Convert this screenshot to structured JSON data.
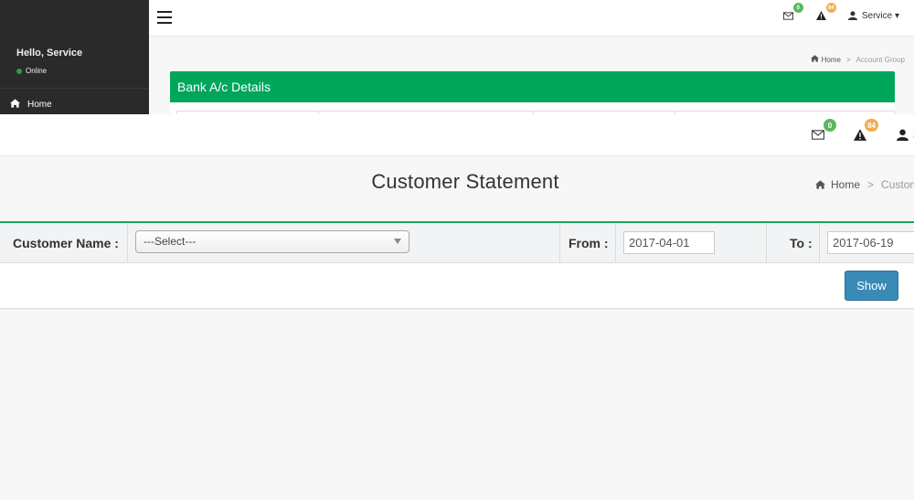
{
  "background_page": {
    "sidebar": {
      "greeting": "Hello, Service",
      "status": "Online",
      "nav_home": "Home"
    },
    "topbar": {
      "mail_count": "0",
      "alert_count": "84",
      "user_label": "Service ▾"
    },
    "breadcrumb": {
      "home": "Home",
      "separator": ">",
      "current": "Account Group"
    },
    "panel_title": "Bank A/c Details"
  },
  "topbar": {
    "mail_count": "0",
    "alert_count": "84",
    "user_label": "S"
  },
  "page": {
    "title": "Customer Statement",
    "breadcrumb": {
      "home": "Home",
      "separator": ">",
      "current": "Custom"
    }
  },
  "filters": {
    "customer_label": "Customer Name :",
    "customer_select_value": "---Select---",
    "from_label": "From :",
    "from_value": "2017-04-01",
    "to_label": "To :",
    "to_value": "2017-06-19"
  },
  "actions": {
    "show_label": "Show"
  },
  "colors": {
    "green_accent": "#00a65a",
    "filter_border": "#1fa35a",
    "button_blue": "#3a8ab8",
    "badge_green": "#5cb85c",
    "badge_orange": "#f0ad4e",
    "sidebar_dark": "#2a2a2a"
  }
}
